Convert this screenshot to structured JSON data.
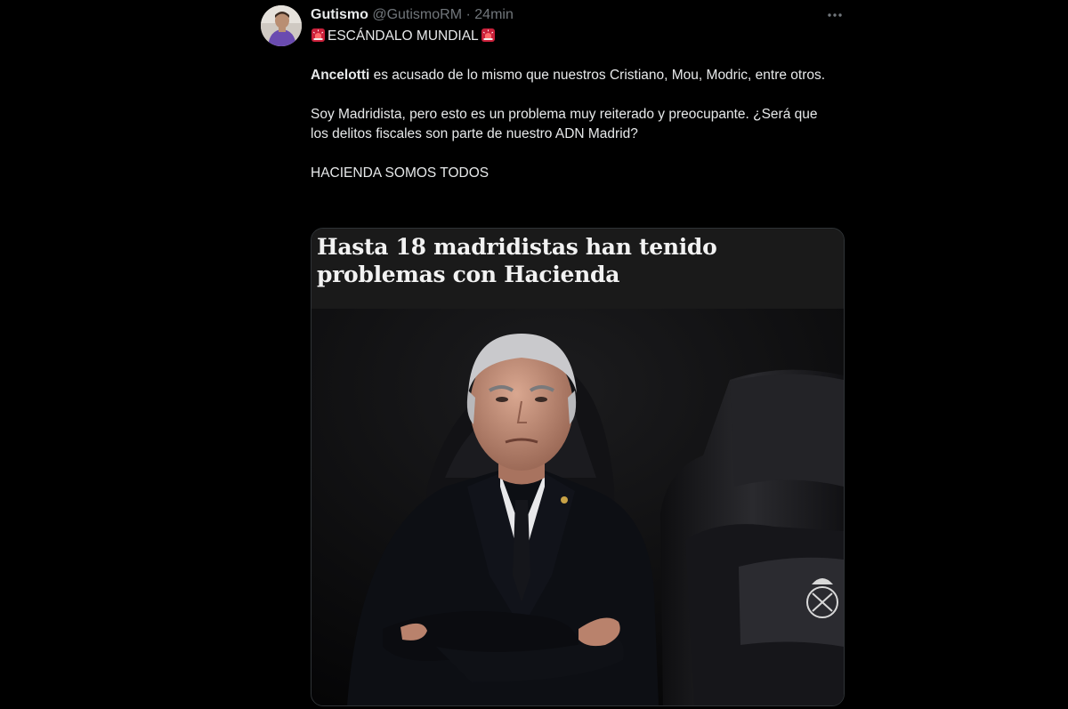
{
  "tweet": {
    "author_name": "Gutismo",
    "author_handle": "@GutismoRM",
    "separator": "·",
    "time": "24min",
    "more_icon": "ellipsis-icon",
    "lines": {
      "title": "ESCÁNDALO MUNDIAL",
      "p1_bold": "Ancelotti",
      "p1_rest": " es acusado de lo mismo que nuestros Cristiano, Mou, Modric, entre otros.",
      "p2": "Soy Madridista, pero esto es un problema muy reiterado y preocupante. ¿Será que los delitos fiscales son parte de nuestro ADN Madrid?",
      "p3": "HACIENDA SOMOS TODOS"
    },
    "title_icon": "siren-emoji"
  },
  "card": {
    "headline": "Hasta 18 madridistas han tenido problemas con Hacienda"
  },
  "colors": {
    "background": "#000000",
    "text": "#e7e9ea",
    "secondary_text": "#71767b",
    "siren": "#e0245e"
  }
}
